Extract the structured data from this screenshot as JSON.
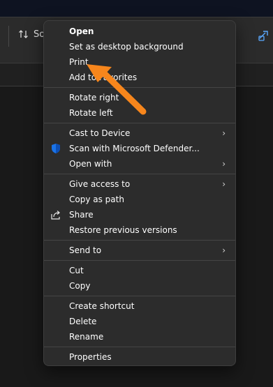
{
  "toolbar": {
    "sort_label": "So",
    "sort_icon": "sort-arrows-icon",
    "right_icon": "link-icon"
  },
  "menu": {
    "groups": [
      [
        {
          "label": "Open",
          "bold": true
        },
        {
          "label": "Set as desktop background"
        },
        {
          "label": "Print"
        },
        {
          "label": "Add to Favorites"
        }
      ],
      [
        {
          "label": "Rotate right"
        },
        {
          "label": "Rotate left"
        }
      ],
      [
        {
          "label": "Cast to Device",
          "submenu": true
        },
        {
          "label": "Scan with Microsoft Defender...",
          "icon": "microsoft-defender-shield-icon"
        },
        {
          "label": "Open with",
          "submenu": true
        }
      ],
      [
        {
          "label": "Give access to",
          "submenu": true
        },
        {
          "label": "Copy as path"
        },
        {
          "label": "Share",
          "icon": "share-icon"
        },
        {
          "label": "Restore previous versions"
        }
      ],
      [
        {
          "label": "Send to",
          "submenu": true
        }
      ],
      [
        {
          "label": "Cut"
        },
        {
          "label": "Copy"
        }
      ],
      [
        {
          "label": "Create shortcut"
        },
        {
          "label": "Delete"
        },
        {
          "label": "Rename"
        }
      ],
      [
        {
          "label": "Properties"
        }
      ]
    ]
  },
  "annotation": {
    "arrow_color": "#f7861c",
    "points_to": "Print"
  },
  "colors": {
    "menu_bg": "#2c2c2c",
    "menu_border": "#3e3e3e",
    "separator": "#454545",
    "defender_blue": "#1a73e8"
  }
}
